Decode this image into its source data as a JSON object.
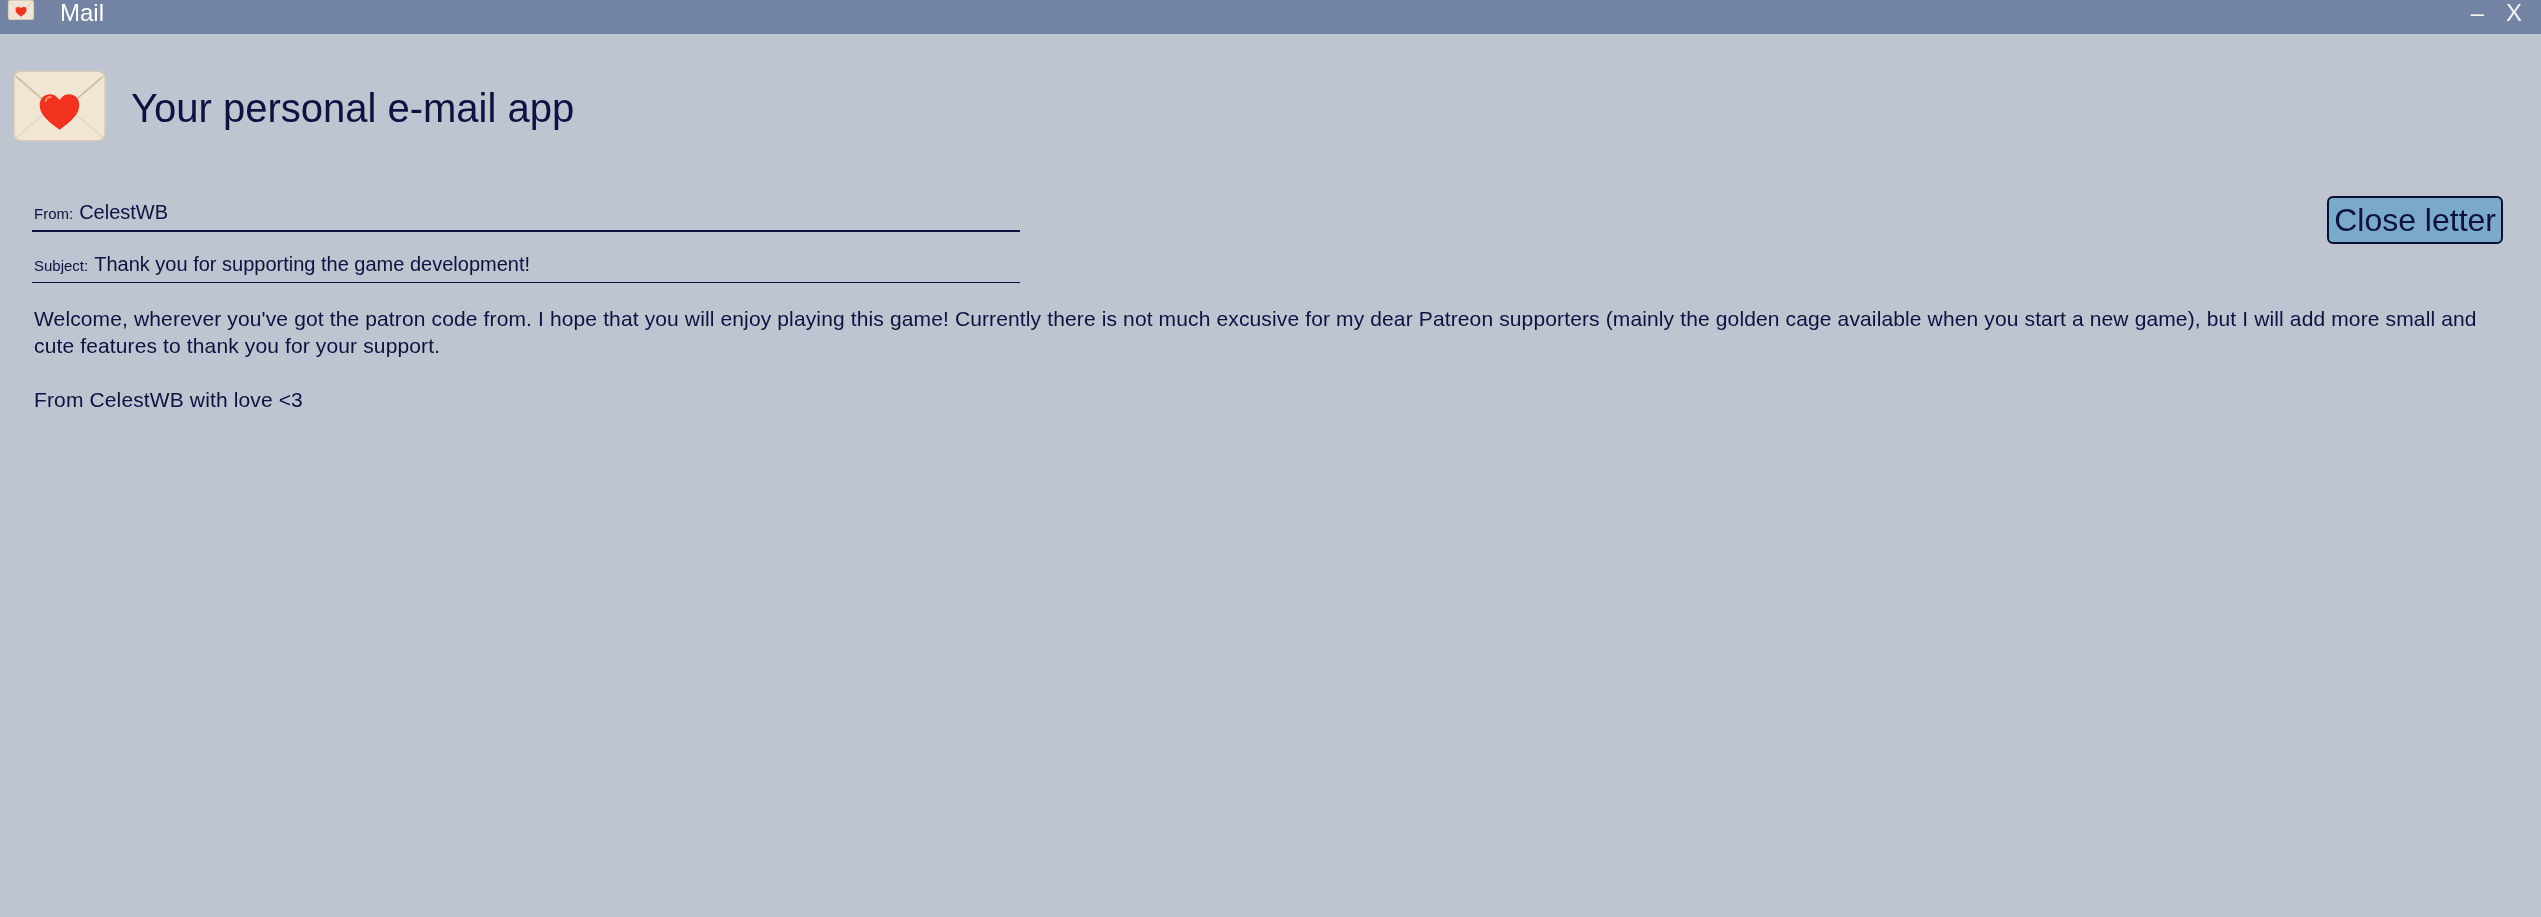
{
  "window": {
    "title": "Mail",
    "controls": [
      "–",
      "X"
    ]
  },
  "header": {
    "title": "Your personal e-mail app"
  },
  "letter": {
    "fields": [
      {
        "label": "From:",
        "value": "CelestWB"
      },
      {
        "label": "Subject:",
        "value": "Thank you for supporting the game development!"
      }
    ],
    "body": [
      "Welcome, wherever you've got the patron code from. I hope that you will enjoy playing this game! Currently there is not much excusive for my dear Patreon supporters (mainly the golden cage available when you start a new game), but I will add more small and cute features to thank you for your support.",
      "From CelestWB with love <3"
    ]
  },
  "close_button": {
    "label": "Close letter"
  }
}
